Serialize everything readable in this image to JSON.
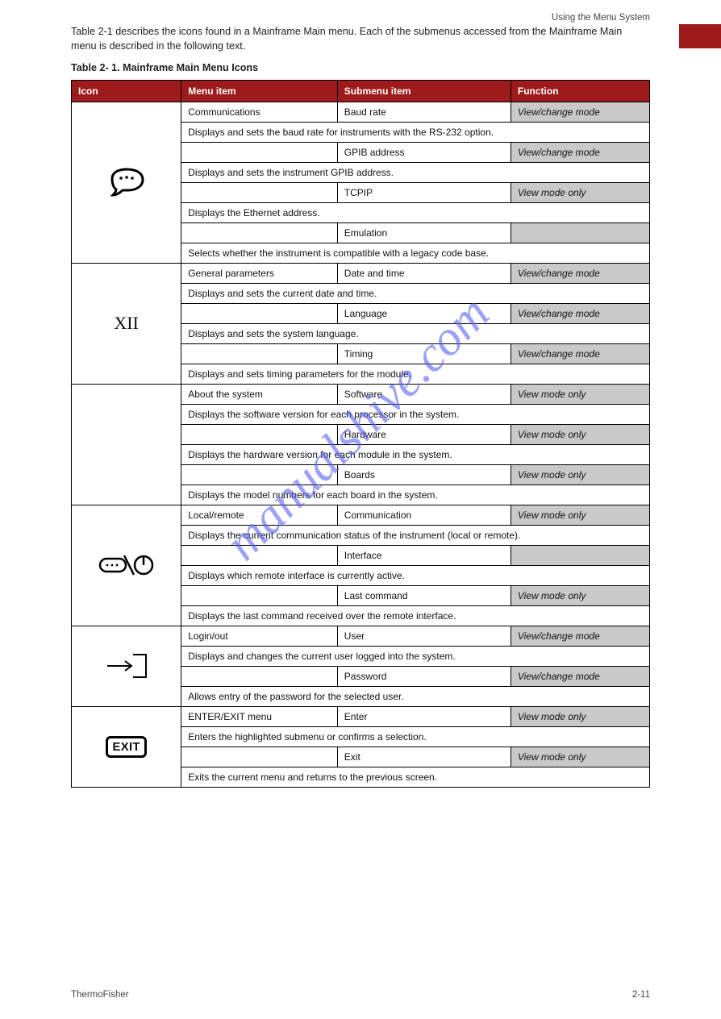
{
  "header_right": "Using the Menu System",
  "intro": "Table 2-1 describes the icons found in a Mainframe Main menu. Each of the submenus accessed from the Mainframe Main menu is described in the following text.",
  "table_caption": "Table 2- 1. Mainframe Main Menu Icons",
  "columns": [
    "Icon",
    "Menu item",
    "Submenu item",
    "Function"
  ],
  "rows": [
    {
      "icon": "speech",
      "menu": "Communications",
      "items": [
        {
          "mode": "View/change mode",
          "sub": "Baud rate",
          "func": "Displays and sets the baud rate for instruments with the RS-232 option."
        },
        {
          "mode": "View/change mode",
          "sub": "GPIB address",
          "func": "Displays and sets the instrument GPIB address."
        },
        {
          "mode": "View mode only",
          "sub": "TCPIP",
          "func": "Displays the Ethernet address."
        },
        {
          "mode": "",
          "sub": "Emulation",
          "func": "Selects whether the instrument is compatible with a legacy code base."
        }
      ]
    },
    {
      "icon": "roman",
      "menu": "General parameters",
      "items": [
        {
          "mode": "View/change mode",
          "sub": "Date and time",
          "func": "Displays and sets the current date and time."
        },
        {
          "mode": "View/change mode",
          "sub": "Language",
          "func": "Displays and sets the system language."
        },
        {
          "mode": "View/change mode",
          "sub": "Timing",
          "func": "Displays and sets timing parameters for the module."
        }
      ]
    },
    {
      "icon": "none",
      "menu": "About the system",
      "items": [
        {
          "mode": "View mode only",
          "sub": "Software",
          "func": "Displays the software version for each processor in the system."
        },
        {
          "mode": "View mode only",
          "sub": "Hardware",
          "func": "Displays the hardware version for each module in the system."
        },
        {
          "mode": "View mode only",
          "sub": "Boards",
          "func": "Displays the model numbers for each board in the system."
        }
      ]
    },
    {
      "icon": "remote",
      "menu": "Local/remote",
      "items": [
        {
          "mode": "View mode only",
          "sub": "Communication",
          "func": "Displays the current communication status of the instrument (local or remote)."
        },
        {
          "mode": "",
          "sub": "Interface",
          "func": "Displays which remote interface is currently active."
        },
        {
          "mode": "View mode only",
          "sub": "Last command",
          "func": "Displays the last command received over the remote interface."
        }
      ]
    },
    {
      "icon": "enter",
      "menu": "Login/out",
      "items": [
        {
          "mode": "View/change mode",
          "sub": "User",
          "func": "Displays and changes the current user logged into the system."
        },
        {
          "mode": "View/change mode",
          "sub": "Password",
          "func": "Allows entry of the password for the selected user."
        }
      ]
    },
    {
      "icon": "exit",
      "menu": "ENTER/EXIT menu",
      "items": [
        {
          "mode": "View mode only",
          "sub": "Enter",
          "func": "Enters the highlighted submenu or confirms a selection."
        },
        {
          "mode": "View mode only",
          "sub": "Exit",
          "func": "Exits the current menu and returns to the previous screen."
        }
      ]
    }
  ],
  "footer_left": "ThermoFisher",
  "footer_right": "2-11"
}
